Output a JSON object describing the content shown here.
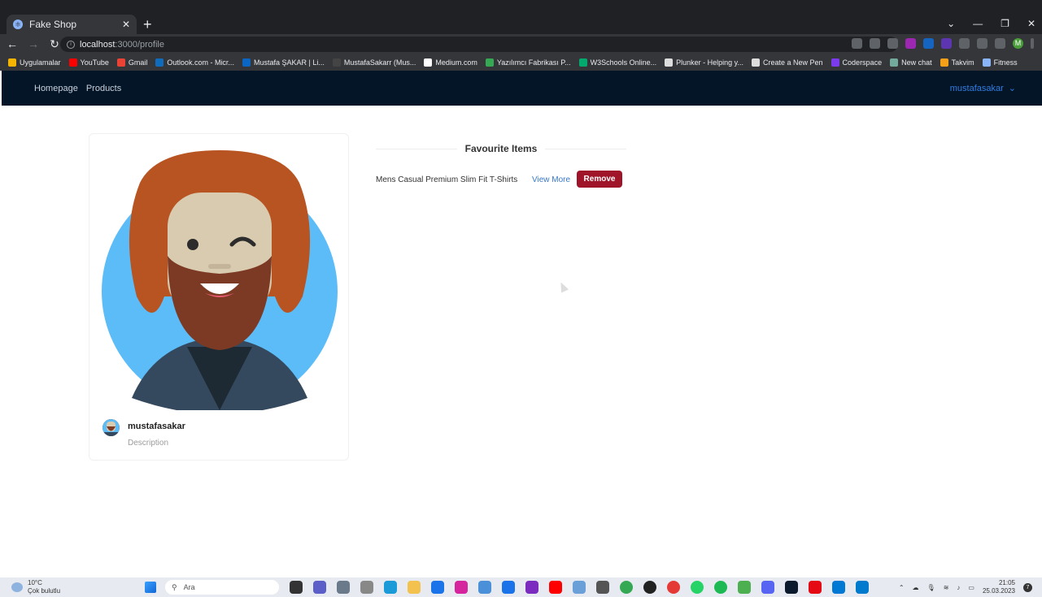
{
  "browser": {
    "tab_title": "Fake Shop",
    "url_host": "localhost",
    "url_path": ":3000/profile",
    "profile_initial": "M",
    "extension_badge": "10"
  },
  "bookmarks": [
    {
      "label": "Uygulamalar",
      "color": "#f4b400"
    },
    {
      "label": "YouTube",
      "color": "#ff0000"
    },
    {
      "label": "Gmail",
      "color": "#ea4335"
    },
    {
      "label": "Outlook.com - Micr...",
      "color": "#0f6cbd"
    },
    {
      "label": "Mustafa ŞAKAR | Li...",
      "color": "#0a66c2"
    },
    {
      "label": "MustafaSakarr (Mus...",
      "color": "#444444"
    },
    {
      "label": "Medium.com",
      "color": "#ffffff"
    },
    {
      "label": "Yazılımcı Fabrikası P...",
      "color": "#34a853"
    },
    {
      "label": "W3Schools Online...",
      "color": "#04aa6d"
    },
    {
      "label": "Plunker - Helping y...",
      "color": "#dddddd"
    },
    {
      "label": "Create a New Pen",
      "color": "#dddddd"
    },
    {
      "label": "Coderspace",
      "color": "#7c3aed"
    },
    {
      "label": "New chat",
      "color": "#74aa9c"
    },
    {
      "label": "Takvim",
      "color": "#f4a019"
    },
    {
      "label": "Fitness",
      "color": "#8ab4f8"
    }
  ],
  "navbar": {
    "links": [
      "Homepage",
      "Products"
    ],
    "user": "mustafasakar"
  },
  "profile": {
    "username": "mustafasakar",
    "description": "Description"
  },
  "favourites": {
    "title": "Favourite Items",
    "items": [
      {
        "name": "Mens Casual Premium Slim Fit T-Shirts",
        "view_label": "View More",
        "remove_label": "Remove"
      }
    ]
  },
  "taskbar": {
    "temperature": "10°C",
    "weather": "Çok bulutlu",
    "search_placeholder": "Ara",
    "time": "21:05",
    "date": "25.03.2023",
    "notification_count": "7"
  },
  "colors": {
    "navbar_bg": "#041528",
    "accent": "#2f7de1",
    "remove_button": "#a0142a",
    "avatar_circle": "#5bbcf7",
    "hair": "#b85422"
  }
}
